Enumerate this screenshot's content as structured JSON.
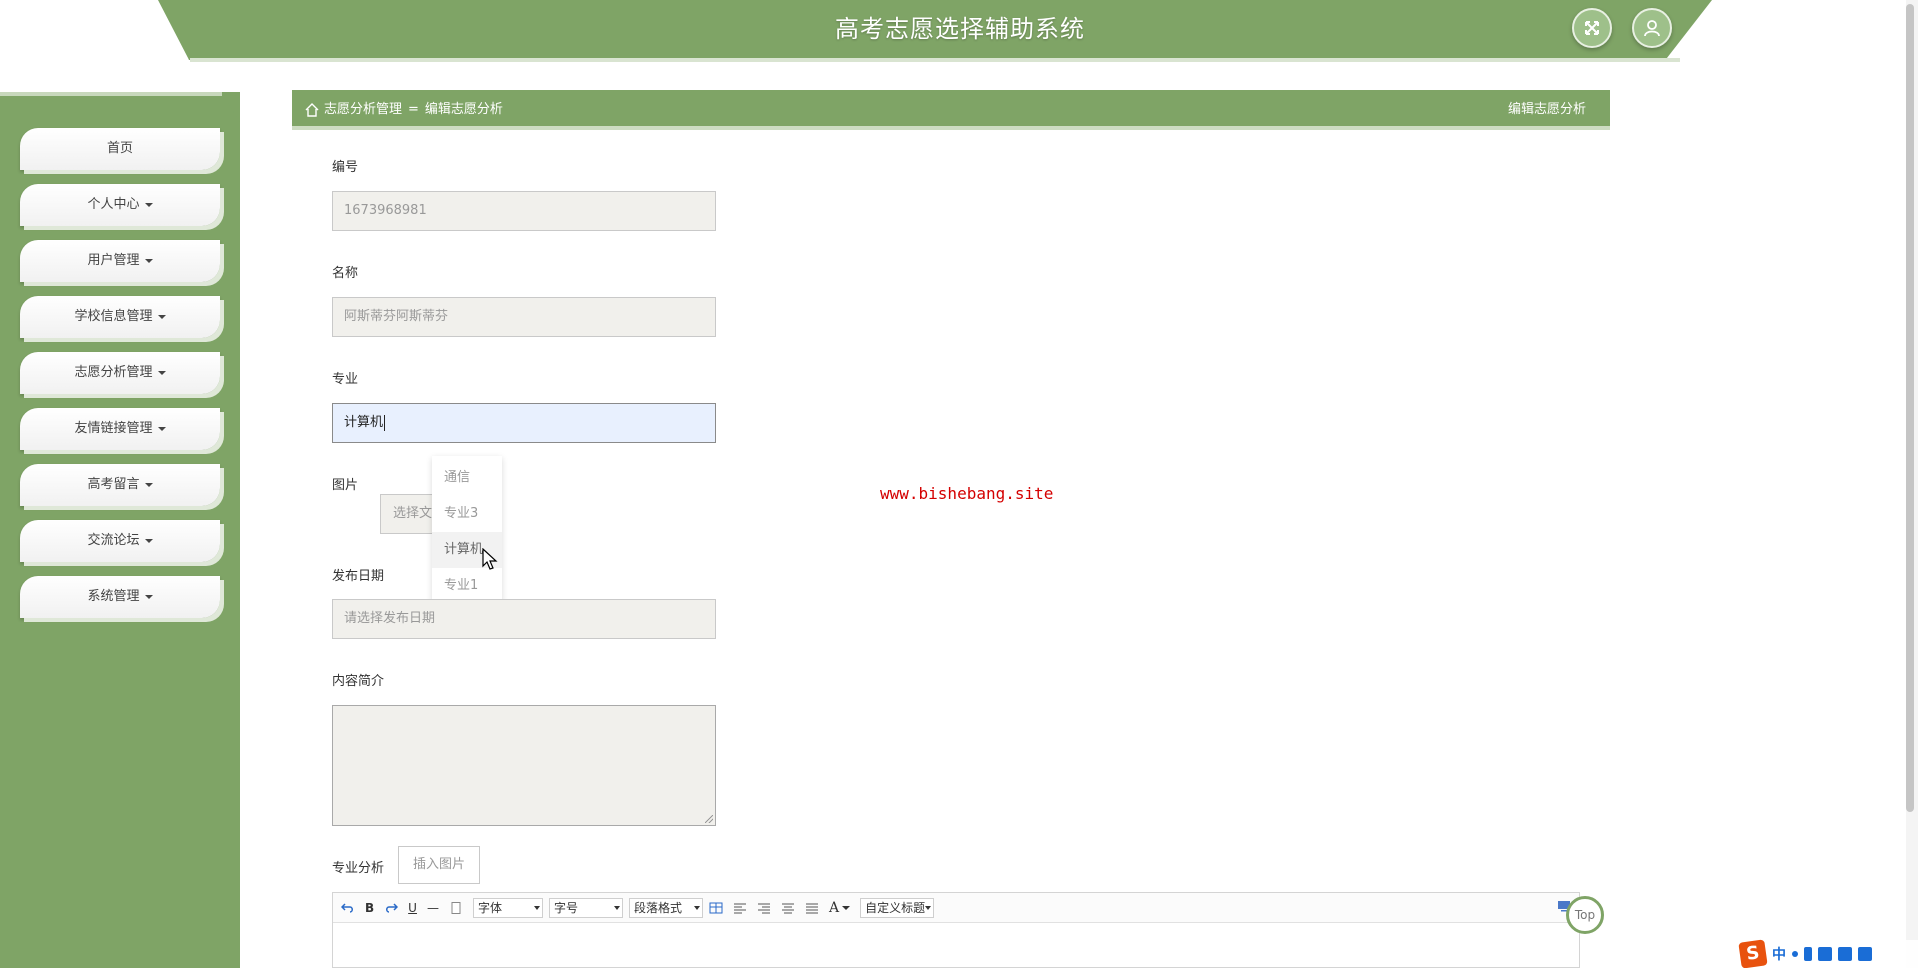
{
  "header": {
    "title": "高考志愿选择辅助系统",
    "fullscreen_icon": "fullscreen-icon",
    "user_icon": "user-icon"
  },
  "sidebar": {
    "items": [
      {
        "label": "首页",
        "dropdown": false
      },
      {
        "label": "个人中心",
        "dropdown": true
      },
      {
        "label": "用户管理",
        "dropdown": true
      },
      {
        "label": "学校信息管理",
        "dropdown": true
      },
      {
        "label": "志愿分析管理",
        "dropdown": true
      },
      {
        "label": "友情链接管理",
        "dropdown": true
      },
      {
        "label": "高考留言",
        "dropdown": true
      },
      {
        "label": "交流论坛",
        "dropdown": true
      },
      {
        "label": "系统管理",
        "dropdown": true
      }
    ]
  },
  "breadcrumb": {
    "parent": "志愿分析管理",
    "separator": "=",
    "current": "编辑志愿分析"
  },
  "panel_title": "编辑志愿分析",
  "form": {
    "id_label": "编号",
    "id_value": "1673968981",
    "name_label": "名称",
    "name_value": "阿斯蒂芬阿斯蒂芬",
    "major_label": "专业",
    "major_value": "计算机",
    "image_label": "图片",
    "file_button": "选择文件",
    "date_label": "发布日期",
    "date_placeholder": "请选择发布日期",
    "intro_label": "内容简介",
    "analysis_label": "专业分析",
    "insert_image_button": "插入图片"
  },
  "major_suggestions": [
    "通信",
    "专业3",
    "计算机",
    "专业1"
  ],
  "editor_toolbar": {
    "font": "字体",
    "size": "字号",
    "paragraph": "段落格式",
    "custom_title": "自定义标题"
  },
  "watermark": "www.bishebang.site",
  "top_button": "Top",
  "ime": {
    "lang": "中"
  },
  "colors": {
    "theme_green": "#7fa466",
    "watermark_red": "#d40000"
  }
}
